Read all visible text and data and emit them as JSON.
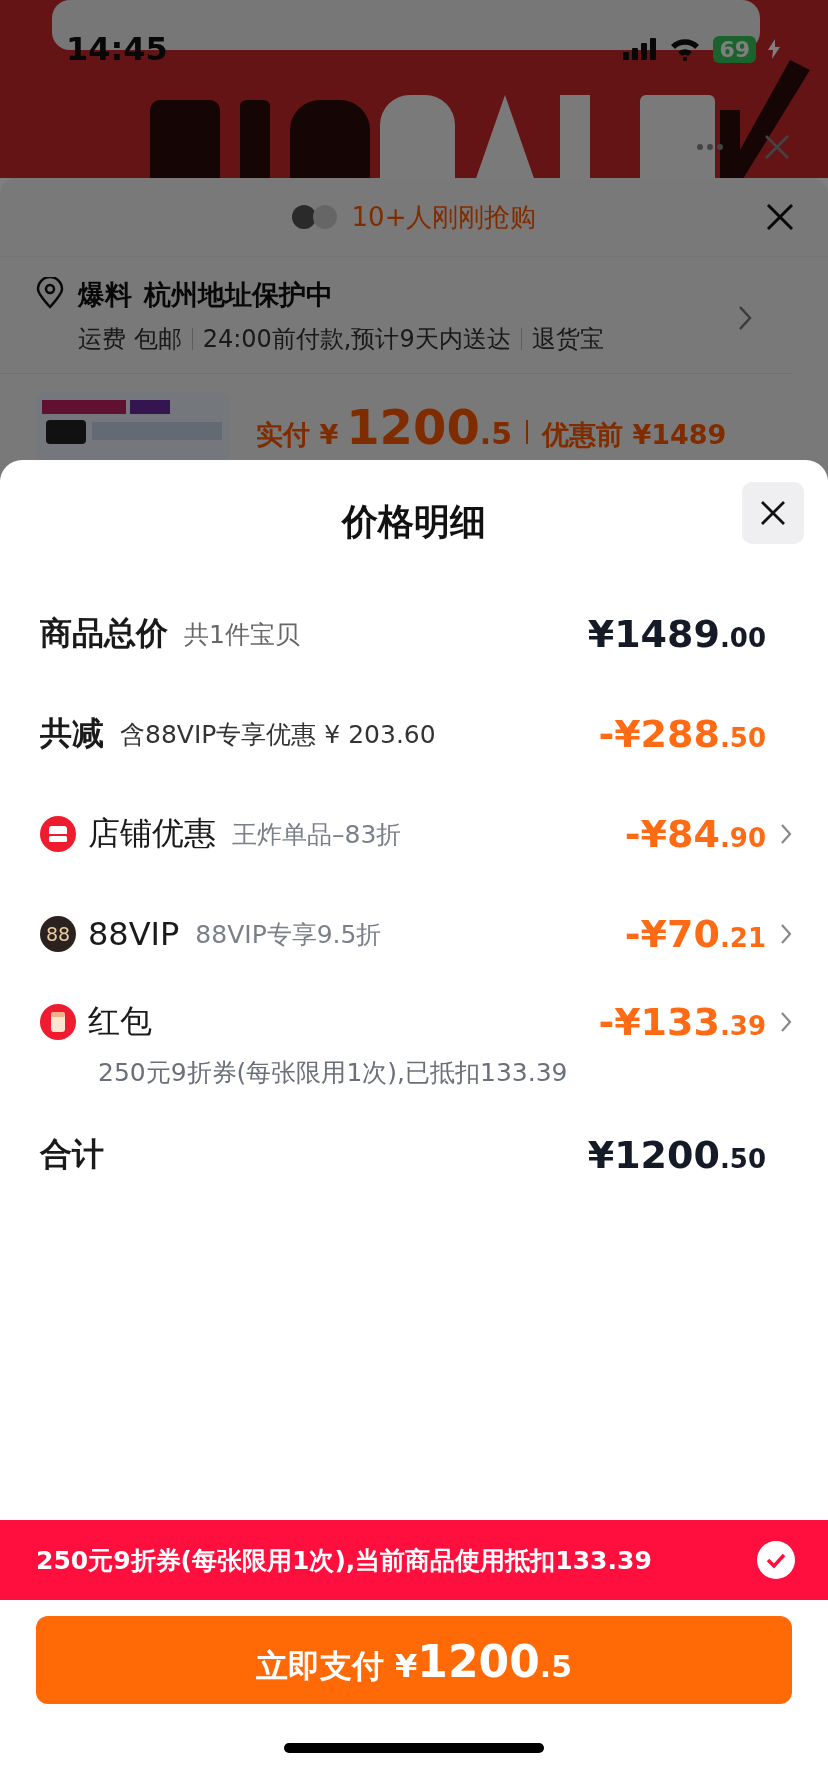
{
  "status_bar": {
    "time": "14:45",
    "battery": "69"
  },
  "background": {
    "order_sheet": {
      "buyers_note": "10+人刚刚抢购",
      "address": {
        "tag": "爆料",
        "text": "杭州地址保护中"
      },
      "delivery": [
        "运费 包邮",
        "24:00前付款,预计9天内送达",
        "退货宝"
      ],
      "product": {
        "paid_label": "实付",
        "currency": "¥",
        "paid_int": "1200",
        "paid_dec": ".5",
        "original_label": "优惠前 ¥1489"
      }
    }
  },
  "price_detail": {
    "title": "价格明细",
    "rows": [
      {
        "kind": "subtotal",
        "label": "商品总价",
        "note": "共1件宝贝",
        "amount": "¥1489",
        "decimals": ".00"
      },
      {
        "kind": "reduction",
        "label": "共减",
        "note": "含88VIP专享优惠 ¥ 203.60",
        "amount": "-¥288",
        "decimals": ".50"
      },
      {
        "kind": "shop",
        "label": "店铺优惠",
        "note": "王炸单品–83折",
        "amount": "-¥84",
        "decimals": ".90"
      },
      {
        "kind": "vip",
        "icon_label": "88",
        "label": "88VIP",
        "note": "88VIP专享9.5折",
        "amount": "-¥70",
        "decimals": ".21"
      },
      {
        "kind": "packet",
        "label": "红包",
        "detail": "250元9折券(每张限用1次),已抵扣133.39",
        "amount": "-¥133",
        "decimals": ".39"
      },
      {
        "kind": "total",
        "label": "合计",
        "amount": "¥1200",
        "decimals": ".50"
      }
    ]
  },
  "coupon_bar": {
    "text": "250元9折券(每张限用1次),当前商品使用抵扣133.39",
    "checked": true
  },
  "pay_button": {
    "label": "立即支付",
    "currency": "¥",
    "amount": "1200",
    "decimals": ".5"
  }
}
